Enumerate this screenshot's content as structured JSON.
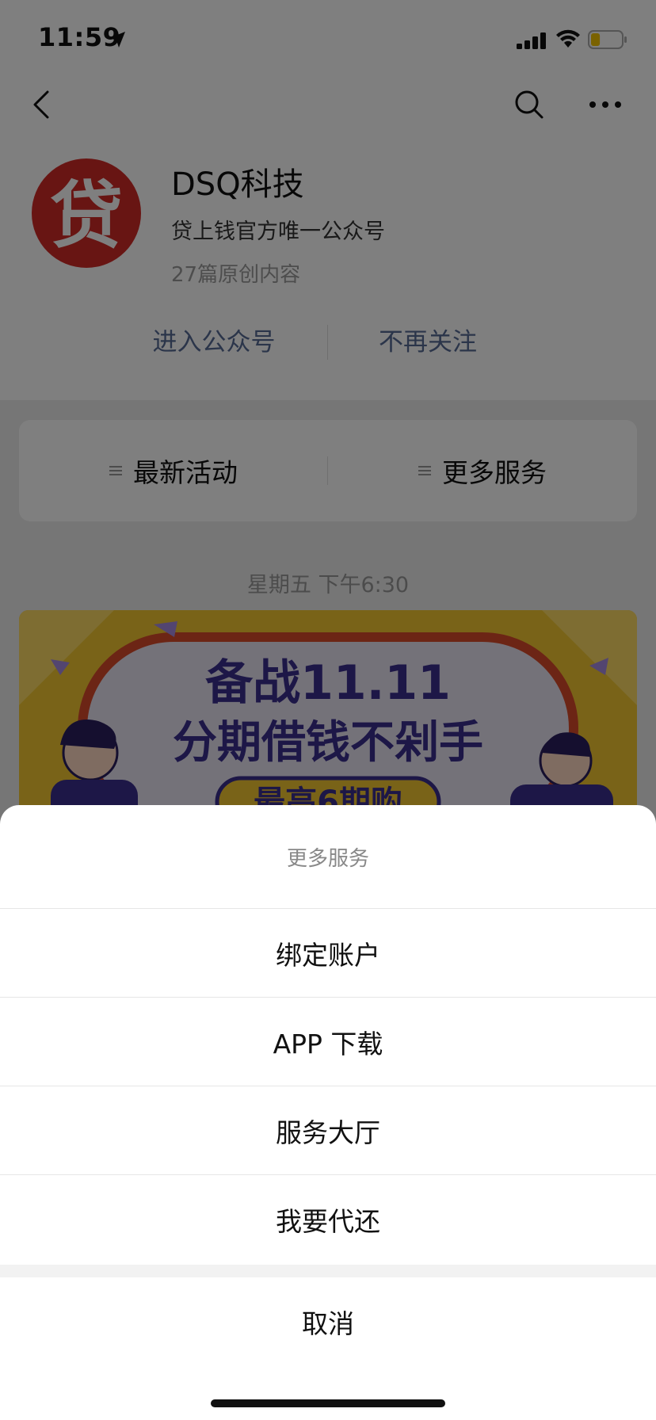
{
  "status_bar": {
    "time": "11:59",
    "location_icon": "location-arrow-icon",
    "signal_icon": "cellular-signal-icon",
    "wifi_icon": "wifi-icon",
    "battery_icon": "battery-icon",
    "battery_level_fraction": 0.3,
    "battery_color": "#f5c400"
  },
  "nav": {
    "back_icon": "back-chevron-icon",
    "search_icon": "search-icon",
    "more_icon": "more-dots-icon"
  },
  "account": {
    "avatar_char": "贷",
    "avatar_color": "#d12a27",
    "name": "DSQ科技",
    "description": "贷上钱官方唯一公众号",
    "meta": "27篇原创内容"
  },
  "actions": {
    "enter_label": "进入公众号",
    "unfollow_label": "不再关注",
    "link_color": "#576b95"
  },
  "menu": {
    "items": [
      {
        "label": "最新活动",
        "icon": "menu-lines-icon"
      },
      {
        "label": "更多服务",
        "icon": "menu-lines-icon"
      }
    ]
  },
  "message": {
    "time": "星期五 下午6:30",
    "banner_line1": "备战11.11",
    "banner_line2": "分期借钱不剁手",
    "banner_line3": "最高6期购",
    "banner_color": "#f3c631"
  },
  "sheet": {
    "title": "更多服务",
    "options": [
      "绑定账户",
      "APP 下载",
      "服务大厅",
      "我要代还"
    ],
    "cancel_label": "取消"
  }
}
